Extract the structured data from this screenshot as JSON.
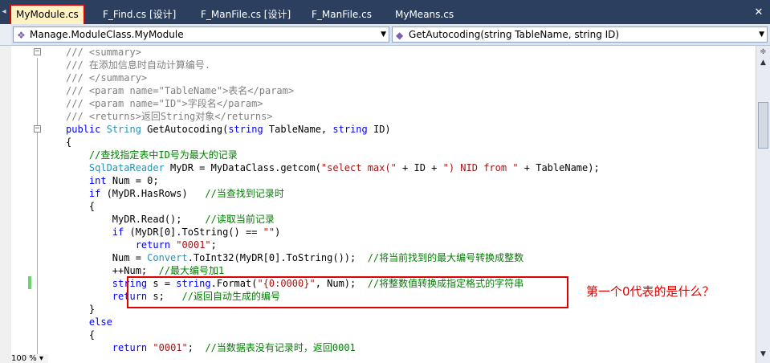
{
  "tabs": [
    {
      "label": "MyModule.cs",
      "active": true
    },
    {
      "label": "F_Find.cs [设计]",
      "active": false
    },
    {
      "label": "F_ManFile.cs [设计]",
      "active": false
    },
    {
      "label": "F_ManFile.cs",
      "active": false
    },
    {
      "label": "MyMeans.cs",
      "active": false
    }
  ],
  "nav": {
    "class_combo": "Manage.ModuleClass.MyModule",
    "member_combo": "GetAutocoding(string TableName, string ID)"
  },
  "code_lines": [
    "/// <summary>",
    "/// 在添加信息时自动计算编号.",
    "/// </summary>",
    "/// <param name=\"TableName\">表名</param>",
    "/// <param name=\"ID\">字段名</param>",
    "/// <returns>返回String对象</returns>",
    "public String GetAutocoding(string TableName, string ID)",
    "{",
    "    //查找指定表中ID号为最大的记录",
    "    SqlDataReader MyDR = MyDataClass.getcom(\"select max(\" + ID + \") NID from \" + TableName);",
    "    int Num = 0;",
    "    if (MyDR.HasRows)   //当查找到记录时",
    "    {",
    "        MyDR.Read();    //读取当前记录",
    "        if (MyDR[0].ToString() == \"\")",
    "            return \"0001\";",
    "        Num = Convert.ToInt32(MyDR[0].ToString());  //将当前找到的最大编号转换成整数",
    "        ++Num;  //最大编号加1",
    "        string s = string.Format(\"{0:0000}\", Num);  //将整数值转换成指定格式的字符串",
    "        return s;   //返回自动生成的编号",
    "    }",
    "    else",
    "    {",
    "        return \"0001\";  //当数据表没有记录时，返回0001"
  ],
  "annotation": "第一个0代表的是什么？",
  "zoom": "100 %",
  "colors": {
    "keyword": "#0000ff",
    "type": "#2b91af",
    "comment": "#008000",
    "doc_comment": "#808080",
    "string": "#a31515",
    "highlight": "#e00000"
  }
}
